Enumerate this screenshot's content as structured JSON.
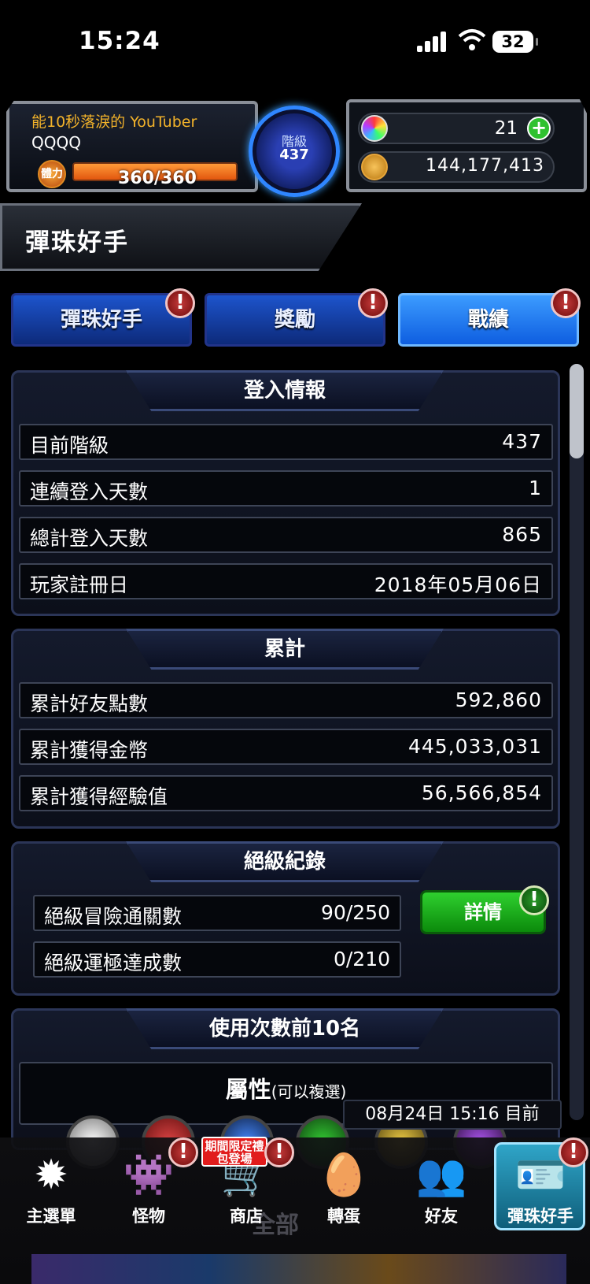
{
  "status_bar": {
    "time": "15:24",
    "battery": "32"
  },
  "header": {
    "title_text": "能10秒落淚的 YouTuber",
    "player_name": "QQQQ",
    "stamina_label": "體力",
    "stamina": "360/360",
    "stamina_fraction": 1.0,
    "rank_label": "階級",
    "rank_value": "437",
    "gems": "21",
    "coins": "144,177,413"
  },
  "page_title": "彈珠好手",
  "tabs": [
    {
      "label": "彈珠好手",
      "active": false,
      "alert": "!"
    },
    {
      "label": "獎勵",
      "active": false,
      "alert": "!"
    },
    {
      "label": "戰績",
      "active": true,
      "alert": "!"
    }
  ],
  "login_info": {
    "title": "登入情報",
    "rows": [
      {
        "key": "目前階級",
        "value": "437"
      },
      {
        "key": "連續登入天數",
        "value": "1"
      },
      {
        "key": "總計登入天數",
        "value": "865"
      },
      {
        "key": "玩家註冊日",
        "value": "2018年05月06日"
      }
    ]
  },
  "totals": {
    "title": "累計",
    "rows": [
      {
        "key": "累計好友點數",
        "value": "592,860"
      },
      {
        "key": "累計獲得金幣",
        "value": "445,033,031"
      },
      {
        "key": "累計獲得經驗值",
        "value": "56,566,854"
      }
    ]
  },
  "ultimate": {
    "title": "絕級紀錄",
    "rows": [
      {
        "key": "絕級冒險通關數",
        "value": "90/250"
      },
      {
        "key": "絕級運極達成數",
        "value": "0/210"
      }
    ],
    "detail_button": "詳情",
    "alert": "!"
  },
  "top10": {
    "title": "使用次數前10名",
    "attribute_label": "屬性",
    "attribute_hint": "(可以複選)",
    "updated": "08月24日 15:16 目前",
    "all_label": "全部"
  },
  "bottom_nav": [
    {
      "label": "主選單",
      "icon": "main-menu-icon"
    },
    {
      "label": "怪物",
      "icon": "monster-icon",
      "alert": "!"
    },
    {
      "label": "商店",
      "icon": "shop-cart-icon",
      "alert": "!",
      "badge": "期間限定禮包登場"
    },
    {
      "label": "轉蛋",
      "icon": "egg-icon"
    },
    {
      "label": "好友",
      "icon": "friends-icon"
    },
    {
      "label": "彈珠好手",
      "icon": "player-card-icon",
      "alert": "!",
      "active": true
    }
  ],
  "colors": {
    "accent_blue": "#1d54cc",
    "alert_red": "#c43a3a",
    "detail_green": "#2fd02f",
    "title_gold": "#f3b32a"
  }
}
